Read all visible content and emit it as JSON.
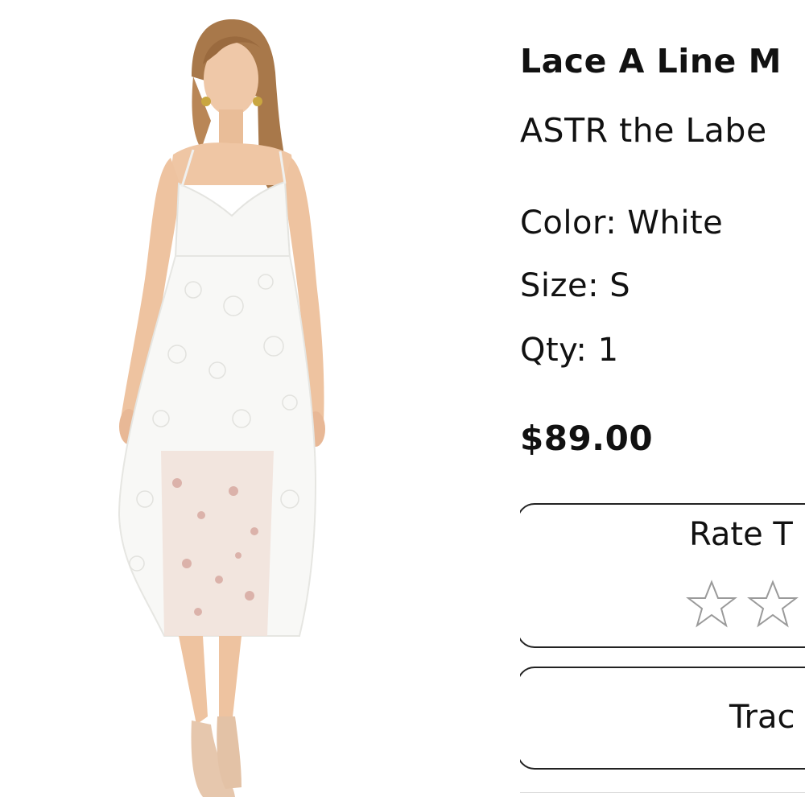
{
  "product": {
    "name": "Lace A Line M",
    "brand": "ASTR the Labe",
    "color_label": "Color: White",
    "size_label": "Size: S",
    "qty_label": "Qty: 1",
    "price": "$89.00",
    "image_icon": "product-photo-white-lace-dress"
  },
  "rating": {
    "title": "Rate T",
    "stars_visible": 2,
    "star_icon": "star-outline-icon"
  },
  "tracking": {
    "label": "Trac"
  },
  "colors": {
    "text": "#111111",
    "border": "#222222",
    "star_stroke": "#9a9a9a",
    "background": "#ffffff"
  }
}
